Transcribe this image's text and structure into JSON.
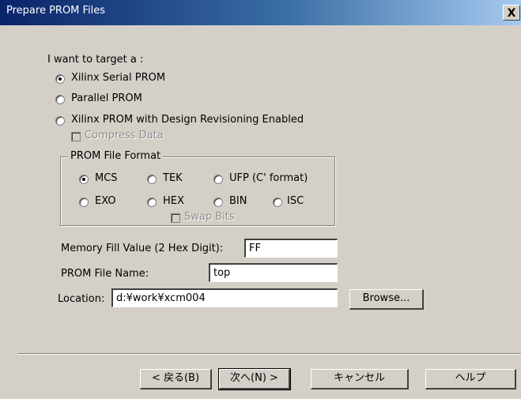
{
  "window": {
    "title": "Prepare PROM Files",
    "close_label": "X"
  },
  "target": {
    "heading": "I want to target a :",
    "options": [
      {
        "label": "Xilinx Serial PROM",
        "checked": true
      },
      {
        "label": "Parallel PROM",
        "checked": false
      },
      {
        "label": "Xilinx PROM with Design Revisioning Enabled",
        "checked": false
      }
    ],
    "compress_label": "Compress Data"
  },
  "format": {
    "legend": "PROM File Format",
    "options": [
      {
        "label": "MCS",
        "checked": true
      },
      {
        "label": "TEK",
        "checked": false
      },
      {
        "label": "UFP (C' format)",
        "checked": false
      },
      {
        "label": "EXO",
        "checked": false
      },
      {
        "label": "HEX",
        "checked": false
      },
      {
        "label": "BIN",
        "checked": false
      },
      {
        "label": "ISC",
        "checked": false
      }
    ],
    "swap_label": "Swap Bits"
  },
  "memory_fill": {
    "label": "Memory Fill Value (2 Hex Digit):",
    "value": "FF"
  },
  "file_name": {
    "label": "PROM File Name:",
    "value": "top"
  },
  "location": {
    "label": "Location:",
    "value": "d:¥work¥xcm004",
    "browse_label": "Browse..."
  },
  "footer": {
    "back_label": "< 戻る(B)",
    "next_label": "次へ(N) >",
    "cancel_label": "キャンセル",
    "help_label": "ヘルプ"
  }
}
